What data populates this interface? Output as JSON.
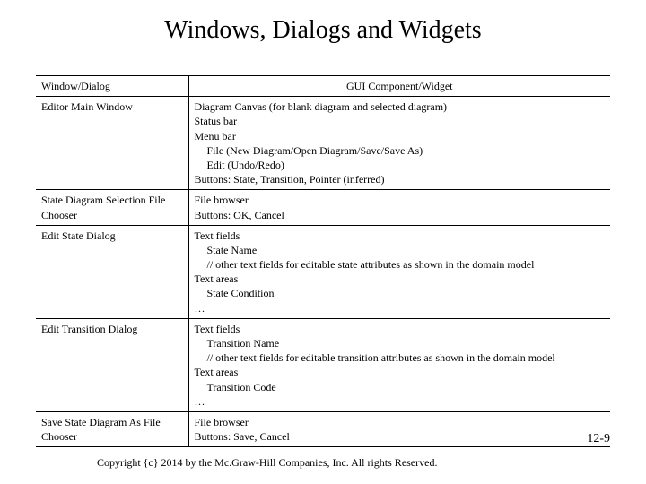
{
  "title": "Windows, Dialogs and Widgets",
  "headers": {
    "col1": "Window/Dialog",
    "col2": "GUI Component/Widget"
  },
  "rows": [
    {
      "window": "Editor Main Window",
      "components_html": "Diagram Canvas (for blank diagram and selected diagram)<br>Status bar<br>Menu bar<br><span class=\"indent1\">File (New Diagram/Open Diagram/Save/Save As)</span><span class=\"indent1\">Edit (Undo/Redo)</span>Buttons: State, Transition, Pointer (inferred)"
    },
    {
      "window": "State Diagram Selection File Chooser",
      "components_html": "File browser<br>Buttons: OK, Cancel"
    },
    {
      "window": "Edit State Dialog",
      "components_html": "Text fields<br><span class=\"indent1\">State Name</span><span class=\"indent1\">// other text fields for editable state attributes as shown in the domain model</span>Text areas<br><span class=\"indent1\">State Condition</span>…"
    },
    {
      "window": "Edit Transition Dialog",
      "components_html": "Text fields<br><span class=\"indent1\">Transition Name</span><span class=\"indent1\">// other text fields for editable transition attributes as shown in the domain model</span>Text areas<br><span class=\"indent1\">Transition Code</span>…"
    },
    {
      "window": "Save State Diagram As File Chooser",
      "components_html": "File browser<br>Buttons: Save, Cancel"
    }
  ],
  "page_number": "12-9",
  "copyright": "Copyright {c} 2014 by the Mc.Graw-Hill Companies, Inc. All rights Reserved."
}
